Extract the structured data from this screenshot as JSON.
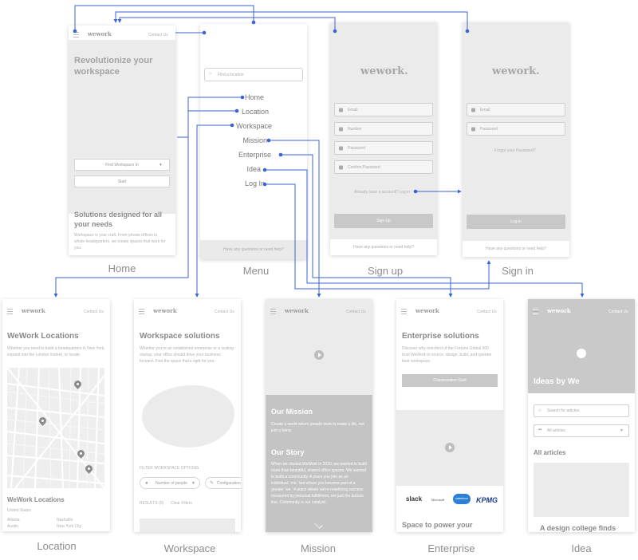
{
  "screens": {
    "home": {
      "caption": "Home",
      "logo": "wework",
      "contact": "Contact Us",
      "hero_title": "Revolutionize your workspace",
      "find_workspace_label": "Find Workspace In",
      "start_label": "Start",
      "solutions_title": "Solutions designed for all your needs",
      "solutions_body": "Workspace is your craft. From private offices to whole headquarters, we create spaces that work for you."
    },
    "menu": {
      "caption": "Menu",
      "search_placeholder": "Find a location",
      "items": [
        "Home",
        "Location",
        "Workspace",
        "Mission",
        "Enterprise",
        "Idea",
        "Log In"
      ],
      "footer": "Have any questions or need help?"
    },
    "signup": {
      "caption": "Sign up",
      "logo": "wework.",
      "fields": [
        "Email",
        "Number",
        "Password",
        "Confirm Password"
      ],
      "have_account": "Already have a account? Log in",
      "button": "Sign Up",
      "footer": "Have any questions or need help?"
    },
    "signin": {
      "caption": "Sign in",
      "logo": "wework.",
      "fields": [
        "Email",
        "Password"
      ],
      "forgot": "Forgot your Password?",
      "button": "Log in",
      "footer": "Have any questions or need help?"
    },
    "location": {
      "caption": "Location",
      "logo": "wework",
      "contact": "Contact Us",
      "title": "WeWork Locations",
      "body": "Whether you need to build a headquarters in New York, expand into the London market, or locate",
      "list_title": "WeWork Locations",
      "country": "United States",
      "cities_left": [
        "Atlanta",
        "Austin"
      ],
      "cities_right": [
        "Nashville",
        "New York City"
      ]
    },
    "workspace": {
      "caption": "Workspace",
      "logo": "wework",
      "contact": "Contact Us",
      "title": "Workspace solutions",
      "body": "Whether you're an established enterprise or a scaling startup, your office should drive your business forward. Find the space that's right for you.",
      "filter_label": "FILTER WORKSPACE OPTIONS",
      "filter_people": "Number of people",
      "filter_config": "Configuration",
      "results": "RESULTS (0)",
      "clear": "Clear Filters"
    },
    "mission": {
      "caption": "Mission",
      "logo": "wework",
      "contact": "Contact Us",
      "mission_title": "Our Mission",
      "mission_body": "Create a world where people work to make a life, not just a living.",
      "story_title": "Our Story",
      "story_body": "When we started WeWork in 2010, we wanted to build more than beautiful, shared office spaces. We wanted to build a community. A place you join as an individual, 'me,' but where you become part of a greater 'we.' A place where we're redefining success measured by personal fulfillment, not just the bottom line. Community is our catalyst."
    },
    "enterprise": {
      "caption": "Enterprise",
      "logo": "wework",
      "contact": "Contact Us",
      "title": "Enterprise solutions",
      "body": "Discover why one-third of the Fortune Global 500 trust WeWork to source, design, build, and operate their workspace.",
      "button": "Conversation Start",
      "brands": [
        "slack",
        "Microsoft",
        "salesforce",
        "KPMG"
      ],
      "bottom_title": "Space to power your"
    },
    "idea": {
      "caption": "Idea",
      "logo": "wework",
      "contact": "Contact Us",
      "hero_title": "Ideas by We",
      "search_placeholder": "Search for articles",
      "dropdown": "All articles",
      "section_title": "All articles",
      "article_title": "A design college finds"
    }
  },
  "colors": {
    "connector": "#3a63d6",
    "placeholder": "#ebebeb",
    "dark_placeholder": "#c9c9c9"
  }
}
